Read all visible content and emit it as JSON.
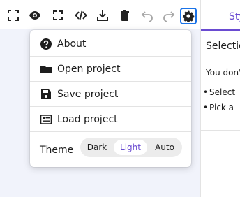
{
  "toolbar": {
    "buttons": [
      {
        "name": "fit-view-button",
        "icon": "fit-view-icon"
      },
      {
        "name": "toggle-view-button",
        "icon": "eye-icon"
      },
      {
        "name": "fullscreen-button",
        "icon": "fullscreen-icon"
      },
      {
        "name": "code-button",
        "icon": "code-icon"
      },
      {
        "name": "download-button",
        "icon": "download-icon"
      },
      {
        "name": "delete-button",
        "icon": "trash-icon"
      },
      {
        "name": "undo-button",
        "icon": "undo-icon",
        "disabled": true
      },
      {
        "name": "redo-button",
        "icon": "redo-icon",
        "disabled": true
      },
      {
        "name": "settings-button",
        "icon": "gear-icon",
        "active": true
      }
    ]
  },
  "menu": {
    "items": [
      {
        "label": "About",
        "icon": "help-circle-icon"
      },
      {
        "label": "Open project",
        "icon": "folder-icon"
      },
      {
        "label": "Save project",
        "icon": "floppy-disk-icon"
      },
      {
        "label": "Load project",
        "icon": "card-list-icon"
      }
    ],
    "theme": {
      "label": "Theme",
      "options": [
        "Dark",
        "Light",
        "Auto"
      ],
      "selected": "Light"
    }
  },
  "right_panel": {
    "tab_label": "Styl",
    "section_title": "Selectio",
    "paragraph": "You don'",
    "bullets": [
      "Select",
      "Pick a"
    ]
  },
  "colors": {
    "accent": "#6a4bd1",
    "canvas": "#f1f3fb",
    "focus": "#1a73e8"
  }
}
